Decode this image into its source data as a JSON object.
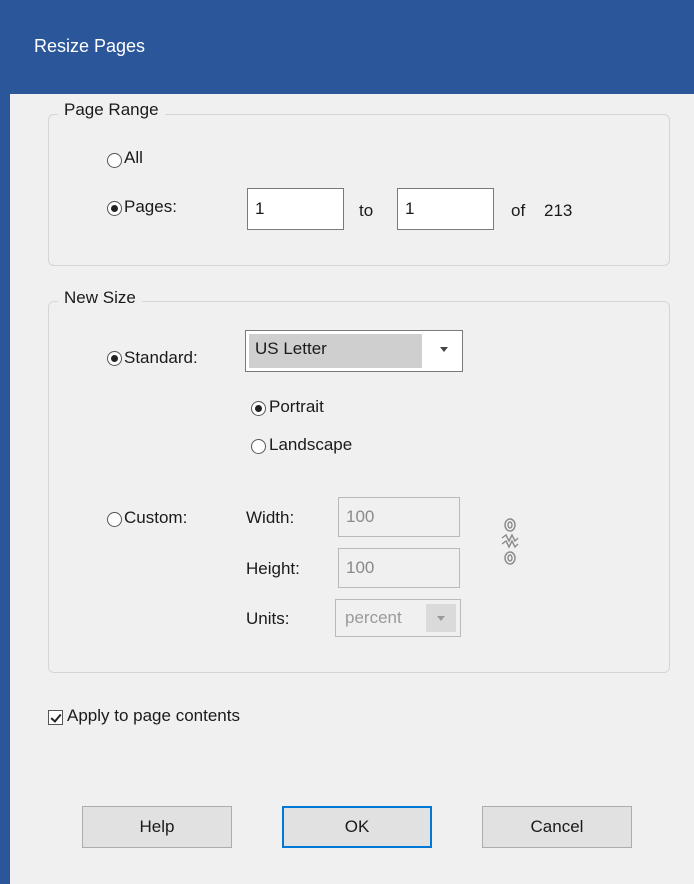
{
  "dialog": {
    "title": "Resize Pages"
  },
  "page_range": {
    "legend": "Page Range",
    "all_label": "All",
    "pages_label": "Pages:",
    "from_value": "1",
    "to_label": "to",
    "to_value": "1",
    "of_label": "of",
    "total_pages": "213",
    "selected": "pages"
  },
  "new_size": {
    "legend": "New Size",
    "standard_label": "Standard:",
    "standard_value": "US Letter",
    "portrait_label": "Portrait",
    "landscape_label": "Landscape",
    "orientation": "portrait",
    "custom_label": "Custom:",
    "width_label": "Width:",
    "width_value": "100",
    "height_label": "Height:",
    "height_value": "100",
    "units_label": "Units:",
    "units_value": "percent",
    "selected": "standard",
    "link_icon": "chain-link-icon"
  },
  "apply_contents": {
    "label": "Apply to page contents",
    "checked": true
  },
  "buttons": {
    "help": "Help",
    "ok": "OK",
    "cancel": "Cancel"
  },
  "colors": {
    "titlebar": "#2b579a",
    "focus_border": "#0078d7",
    "background": "#f0f0f0"
  }
}
